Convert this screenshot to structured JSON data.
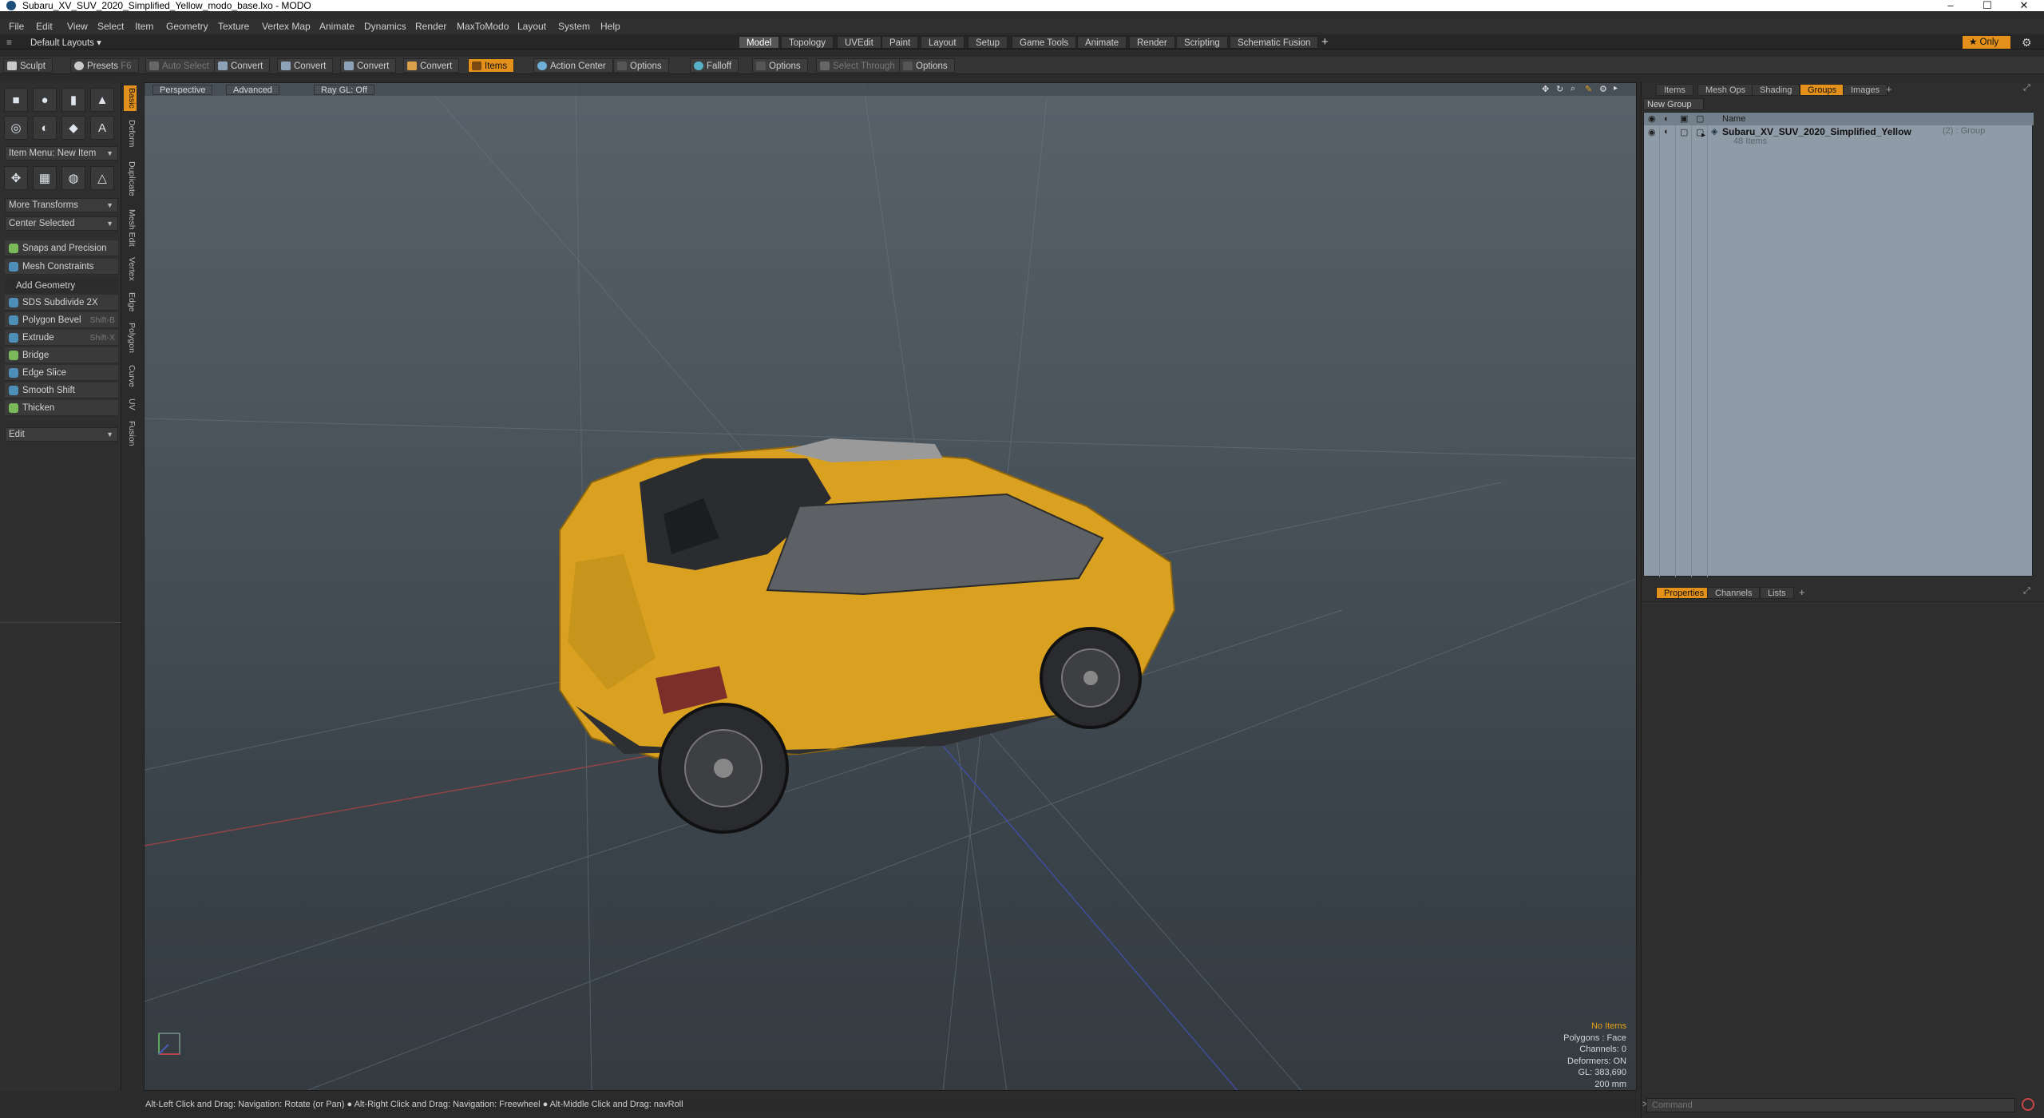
{
  "window": {
    "title": "Subaru_XV_SUV_2020_Simplified_Yellow_modo_base.lxo - MODO",
    "minimize": "–",
    "maximize": "☐",
    "close": "✕"
  },
  "menu": [
    "File",
    "Edit",
    "View",
    "Select",
    "Item",
    "Geometry",
    "Texture",
    "Vertex Map",
    "Animate",
    "Dynamics",
    "Render",
    "MaxToModo",
    "Layout",
    "System",
    "Help"
  ],
  "layoutbar": {
    "layouts_label": "Default Layouts ▾",
    "tabs": [
      "Model",
      "Topology",
      "UVEdit",
      "Paint",
      "Layout",
      "Setup",
      "Game Tools",
      "Animate",
      "Render",
      "Scripting",
      "Schematic Fusion"
    ],
    "active_tab": "Model",
    "add": "+",
    "only_label": "Only"
  },
  "toolbar": {
    "sculpt": "Sculpt",
    "presets": "Presets",
    "presets_key": "F6",
    "auto_select": "Auto Select",
    "convert": "Convert",
    "items": "Items",
    "action_center": "Action Center",
    "options": "Options",
    "falloff": "Falloff",
    "select_through": "Select Through"
  },
  "leftpanel": {
    "item_menu": "Item Menu: New Item",
    "more_transforms": "More Transforms",
    "center_selected": "Center Selected",
    "snaps": "Snaps and Precision",
    "mesh_constraints": "Mesh Constraints",
    "add_geometry": "Add Geometry",
    "tools": [
      {
        "label": "SDS Subdivide 2X",
        "shortcut": ""
      },
      {
        "label": "Polygon Bevel",
        "shortcut": "Shift-B"
      },
      {
        "label": "Extrude",
        "shortcut": "Shift-X"
      },
      {
        "label": "Bridge",
        "shortcut": ""
      },
      {
        "label": "Edge Slice",
        "shortcut": ""
      },
      {
        "label": "Smooth Shift",
        "shortcut": ""
      },
      {
        "label": "Thicken",
        "shortcut": ""
      }
    ],
    "edit": "Edit",
    "vtabs": [
      "Basic",
      "Deform",
      "Duplicate",
      "Mesh Edit",
      "Vertex",
      "Edge",
      "Polygon",
      "Curve",
      "UV",
      "Fusion"
    ]
  },
  "viewport": {
    "perspective": "Perspective",
    "advanced": "Advanced",
    "raygl": "Ray GL: Off",
    "info": {
      "no_items": "No Items",
      "polygons": "Polygons : Face",
      "channels": "Channels: 0",
      "deformers": "Deformers: ON",
      "gl": "GL: 383,690",
      "scale": "200 mm"
    }
  },
  "statusbar": "Alt-Left Click and Drag: Navigation: Rotate (or Pan) ● Alt-Right Click and Drag: Navigation: Freewheel ● Alt-Middle Click and Drag: navRoll",
  "rightpanel": {
    "top_tabs": [
      "Items",
      "Mesh Ops",
      "Shading",
      "Groups",
      "Images"
    ],
    "active_top": "Groups",
    "new_group": "New Group",
    "col_name": "Name",
    "group_name": "Subaru_XV_SUV_2020_Simplified_Yellow",
    "group_count": "(2) : Group",
    "group_items": "48 Items",
    "bottom_tabs": [
      "Properties",
      "Channels",
      "Lists"
    ],
    "active_bottom": "Properties",
    "command_placeholder": "Command"
  }
}
